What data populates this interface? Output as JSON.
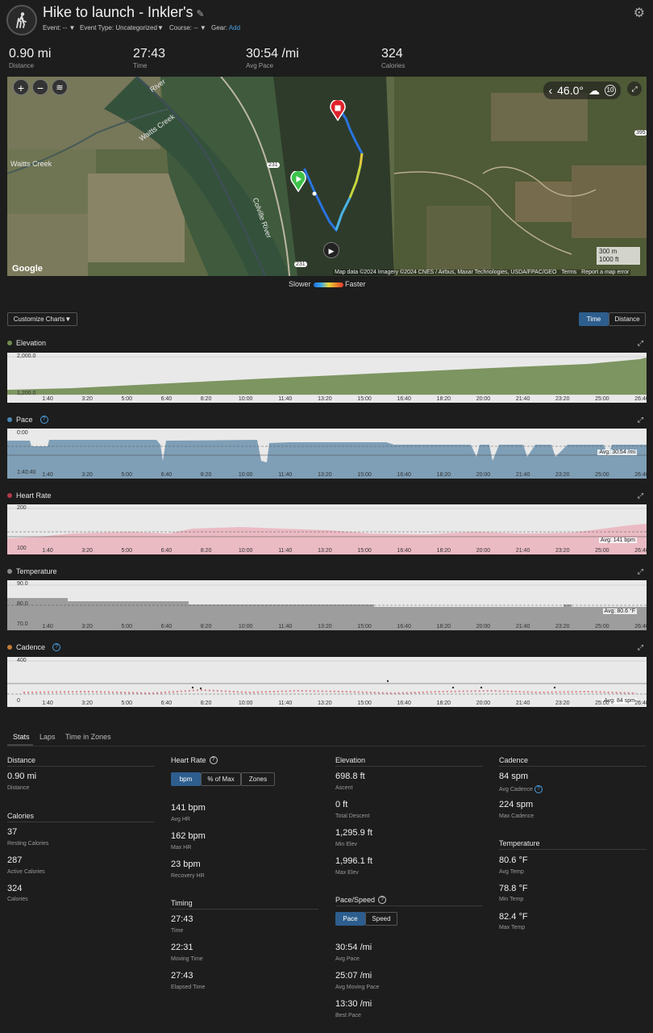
{
  "header": {
    "title": "Hike to launch - Inkler's",
    "event_label": "Event:",
    "event_value": "--",
    "event_type_label": "Event Type:",
    "event_type_value": "Uncategorized",
    "course_label": "Course:",
    "course_value": "--",
    "gear_label": "Gear:",
    "gear_value": "Add"
  },
  "summary": [
    {
      "value": "0.90 mi",
      "label": "Distance"
    },
    {
      "value": "27:43",
      "label": "Time"
    },
    {
      "value": "30:54 /mi",
      "label": "Avg Pace"
    },
    {
      "value": "324",
      "label": "Calories"
    }
  ],
  "map": {
    "temperature": "46.0°",
    "weather_badge": "10",
    "scale_m": "300 m",
    "scale_ft": "1000 ft",
    "attribution": "Map data ©2024 Imagery ©2024 CNES / Airbus, Maxar Technologies, USDA/FPAC/GEO",
    "terms": "Terms",
    "report": "Report a map error",
    "google": "Google",
    "legend_slower": "Slower",
    "legend_faster": "Faster",
    "labels": [
      "Waitts Creek",
      "Waitts Creek",
      "Colville River",
      "River",
      "231",
      "231",
      "395"
    ]
  },
  "controls": {
    "customize_charts": "Customize Charts",
    "time_button": "Time",
    "distance_button": "Distance"
  },
  "x_ticks": [
    "1:40",
    "3:20",
    "5:00",
    "6:40",
    "8:20",
    "10:00",
    "11:40",
    "13:20",
    "15:00",
    "16:40",
    "18:20",
    "20:00",
    "21:40",
    "23:20",
    "25:00",
    "26:40"
  ],
  "charts": {
    "elevation": {
      "title": "Elevation",
      "y_top": "2,000.0",
      "y_bottom": "1,200.0"
    },
    "pace": {
      "title": "Pace",
      "y_top": "0:00",
      "y_bottom": "1:40:40",
      "avg": "Avg: 30:54 /mi"
    },
    "heart_rate": {
      "title": "Heart Rate",
      "y_top": "200",
      "y_bottom": "100",
      "avg": "Avg: 141 bpm"
    },
    "temperature": {
      "title": "Temperature",
      "y_top": "90.0",
      "y_mid": "80.0",
      "y_bottom": "70.0",
      "avg": "Avg: 80.6 °F"
    },
    "cadence": {
      "title": "Cadence",
      "y_top": "400",
      "y_bottom": "0",
      "avg": "Avg: 84 spm"
    }
  },
  "colors": {
    "elevation": "#6f8a4e",
    "pace": "#7fa3bd",
    "heart_rate": "#e8b6bf",
    "temperature": "#9a9a9a",
    "cadence": "#d9838f",
    "accent": "#2d5e8e"
  },
  "tabs": [
    "Stats",
    "Laps",
    "Time in Zones"
  ],
  "stats": {
    "distance": {
      "title": "Distance",
      "items": [
        {
          "value": "0.90 mi",
          "label": "Distance"
        }
      ]
    },
    "calories": {
      "title": "Calories",
      "items": [
        {
          "value": "37",
          "label": "Resting Calories"
        },
        {
          "value": "287",
          "label": "Active Calories"
        },
        {
          "value": "324",
          "label": "Calories"
        }
      ]
    },
    "heart_rate": {
      "title": "Heart Rate",
      "buttons": [
        "bpm",
        "% of Max",
        "Zones"
      ],
      "items": [
        {
          "value": "141 bpm",
          "label": "Avg HR"
        },
        {
          "value": "162 bpm",
          "label": "Max HR"
        },
        {
          "value": "23 bpm",
          "label": "Recovery HR"
        }
      ]
    },
    "timing": {
      "title": "Timing",
      "items": [
        {
          "value": "27:43",
          "label": "Time"
        },
        {
          "value": "22:31",
          "label": "Moving Time"
        },
        {
          "value": "27:43",
          "label": "Elapsed Time"
        }
      ]
    },
    "elevation": {
      "title": "Elevation",
      "items": [
        {
          "value": "698.8 ft",
          "label": "Ascent"
        },
        {
          "value": "0 ft",
          "label": "Total Descent"
        },
        {
          "value": "1,295.9 ft",
          "label": "Min Elev"
        },
        {
          "value": "1,996.1 ft",
          "label": "Max Elev"
        }
      ]
    },
    "pace_speed": {
      "title": "Pace/Speed",
      "buttons": [
        "Pace",
        "Speed"
      ],
      "items": [
        {
          "value": "30:54 /mi",
          "label": "Avg Pace"
        },
        {
          "value": "25:07 /mi",
          "label": "Avg Moving Pace"
        },
        {
          "value": "13:30 /mi",
          "label": "Best Pace"
        }
      ]
    },
    "cadence": {
      "title": "Cadence",
      "items": [
        {
          "value": "84 spm",
          "label": "Avg Cadence"
        },
        {
          "value": "224 spm",
          "label": "Max Cadence"
        }
      ]
    },
    "temperature": {
      "title": "Temperature",
      "items": [
        {
          "value": "80.6 °F",
          "label": "Avg Temp"
        },
        {
          "value": "78.8 °F",
          "label": "Min Temp"
        },
        {
          "value": "82.4 °F",
          "label": "Max Temp"
        }
      ]
    }
  }
}
